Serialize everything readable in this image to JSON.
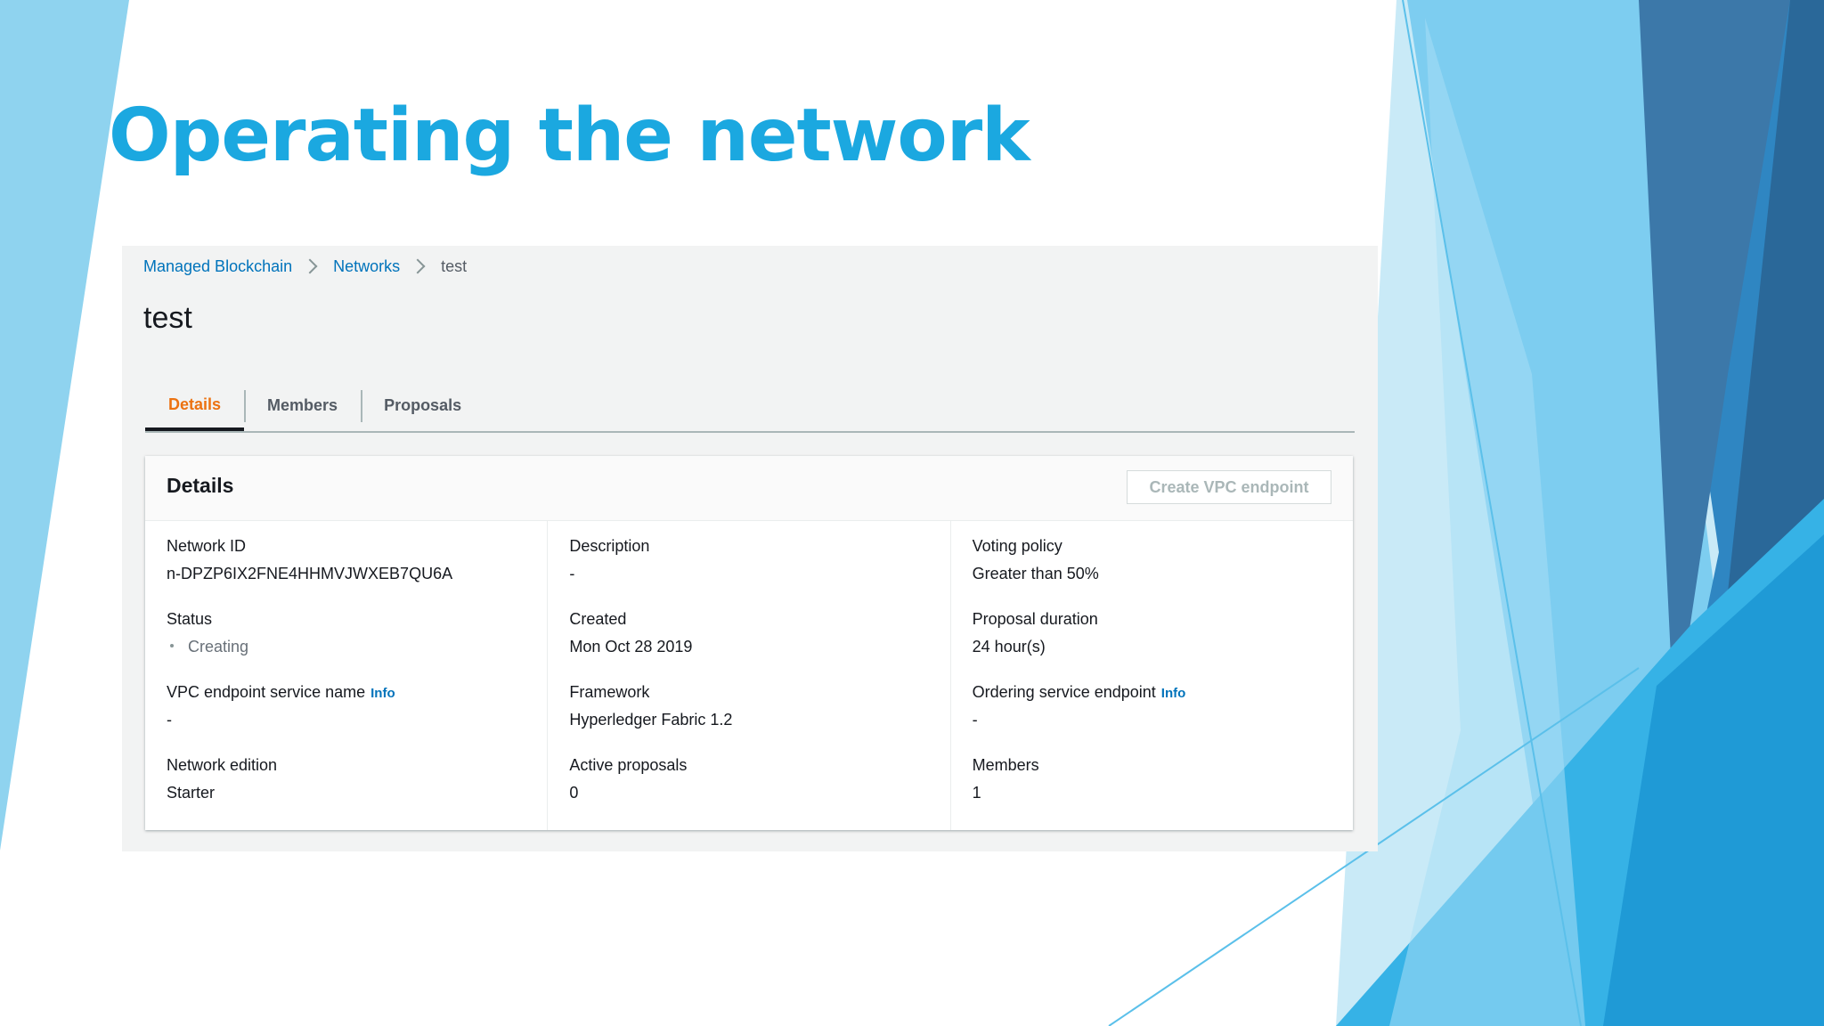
{
  "slide": {
    "title": "Operating the network"
  },
  "colors": {
    "title": "#1ba8e0",
    "tab_active": "#ec7211",
    "link": "#0073bb"
  },
  "breadcrumb": {
    "items": [
      "Managed Blockchain",
      "Networks",
      "test"
    ],
    "separator_icon": "chevron-right-icon"
  },
  "page": {
    "heading": "test"
  },
  "tabs": [
    {
      "label": "Details",
      "active": true
    },
    {
      "label": "Members",
      "active": false
    },
    {
      "label": "Proposals",
      "active": false
    }
  ],
  "details": {
    "title": "Details",
    "create_vpc_label": "Create VPC endpoint",
    "info_label": "Info",
    "network_id": {
      "label": "Network ID",
      "value": "n-DPZP6IX2FNE4HHMVJWXEB7QU6A"
    },
    "status": {
      "label": "Status",
      "value": "Creating",
      "icon": "pending-icon"
    },
    "vpc_service_name": {
      "label": "VPC endpoint service name",
      "value": "-"
    },
    "network_edition": {
      "label": "Network edition",
      "value": "Starter"
    },
    "description": {
      "label": "Description",
      "value": "-"
    },
    "created": {
      "label": "Created",
      "value": "Mon Oct 28 2019"
    },
    "framework": {
      "label": "Framework",
      "value": "Hyperledger Fabric 1.2"
    },
    "active_proposals": {
      "label": "Active proposals",
      "value": "0"
    },
    "voting_policy": {
      "label": "Voting policy",
      "value": "Greater than 50%"
    },
    "proposal_duration": {
      "label": "Proposal duration",
      "value": "24 hour(s)"
    },
    "ordering_endpoint": {
      "label": "Ordering service endpoint",
      "value": "-"
    },
    "members": {
      "label": "Members",
      "value": "1"
    }
  }
}
